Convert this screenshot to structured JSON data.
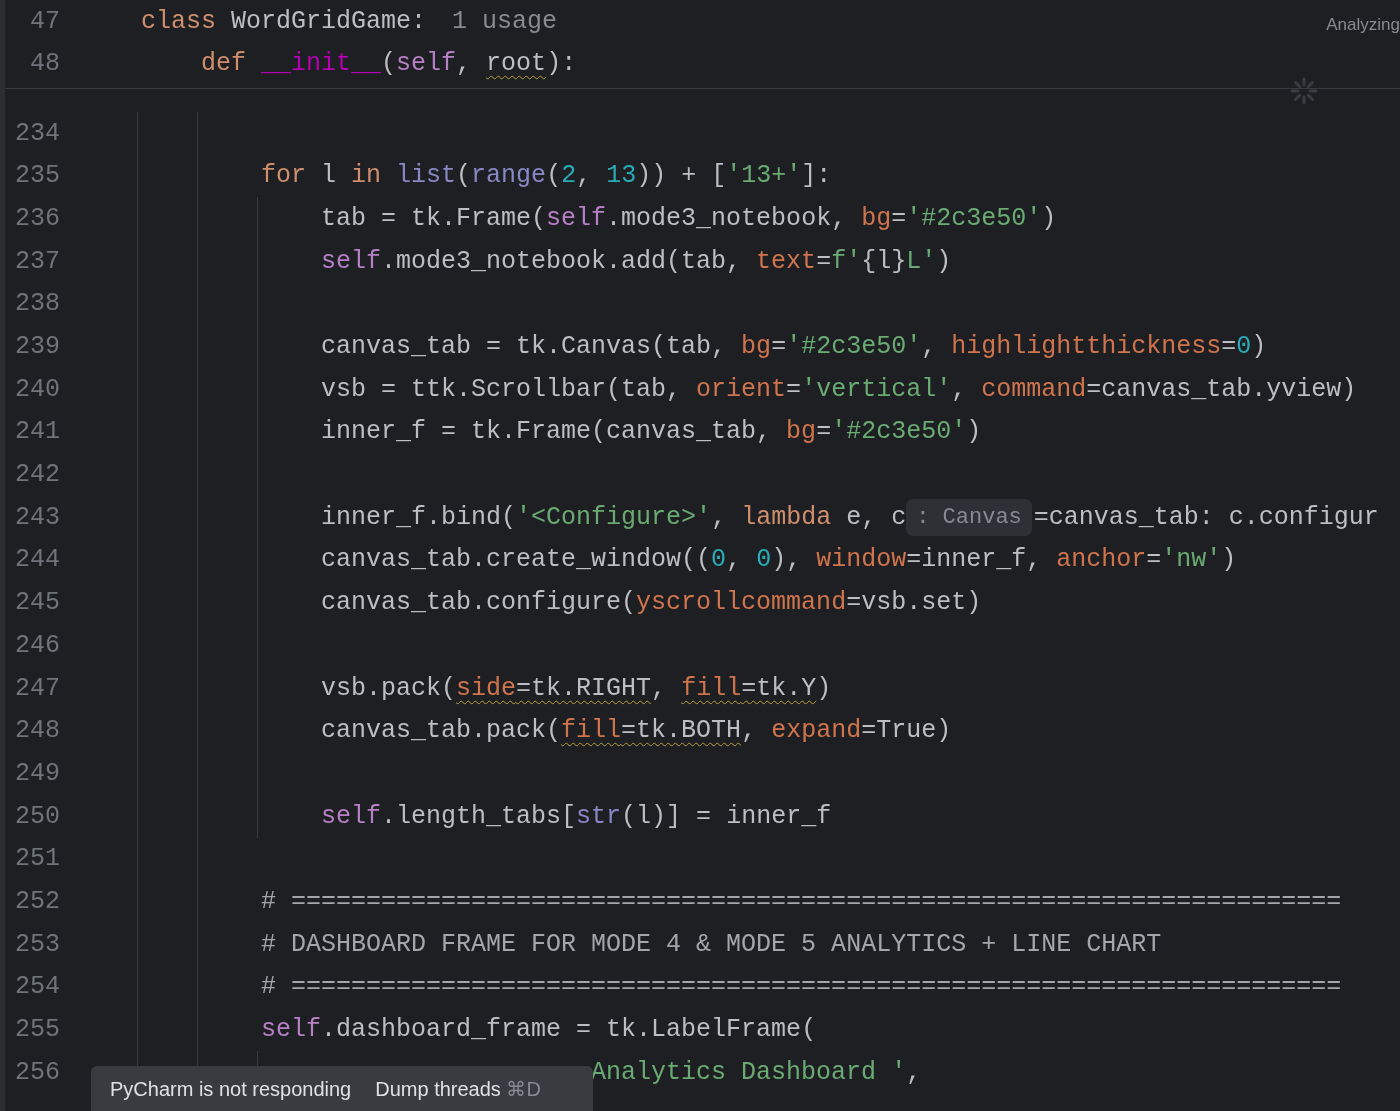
{
  "sticky_lines": [
    {
      "number": "47",
      "tokens": [
        {
          "text": "class",
          "kind": "kw"
        },
        {
          "text": " WordGridGame:",
          "kind": "plain"
        },
        {
          "text": "1 usage",
          "kind": "usage"
        }
      ]
    },
    {
      "number": "48",
      "tokens": [
        {
          "text": "    def ",
          "kind": "kw"
        },
        {
          "text": "__init__",
          "kind": "magic"
        },
        {
          "text": "(",
          "kind": "plain"
        },
        {
          "text": "self",
          "kind": "self"
        },
        {
          "text": ", ",
          "kind": "plain"
        },
        {
          "text": "root",
          "kind": "plain",
          "warn": true
        },
        {
          "text": "):",
          "kind": "plain"
        }
      ]
    }
  ],
  "status": "Analyzing",
  "lines": [
    {
      "number": "234"
    },
    {
      "number": "235",
      "tokens": [
        {
          "text": "        for",
          "kind": "kw"
        },
        {
          "text": " l ",
          "kind": "plain"
        },
        {
          "text": "in ",
          "kind": "kw"
        },
        {
          "text": "list",
          "kind": "builtin"
        },
        {
          "text": "(",
          "kind": "plain"
        },
        {
          "text": "range",
          "kind": "builtin"
        },
        {
          "text": "(",
          "kind": "plain"
        },
        {
          "text": "2",
          "kind": "num"
        },
        {
          "text": ", ",
          "kind": "plain"
        },
        {
          "text": "13",
          "kind": "num"
        },
        {
          "text": ")) + [",
          "kind": "plain"
        },
        {
          "text": "'13+'",
          "kind": "str"
        },
        {
          "text": "]:",
          "kind": "plain"
        }
      ]
    },
    {
      "number": "236",
      "tokens": [
        {
          "text": "            tab = tk.Frame(",
          "kind": "plain"
        },
        {
          "text": "self",
          "kind": "self"
        },
        {
          "text": ".mode3_notebook, ",
          "kind": "plain"
        },
        {
          "text": "bg",
          "kind": "param"
        },
        {
          "text": "=",
          "kind": "plain"
        },
        {
          "text": "'#2c3e50'",
          "kind": "str"
        },
        {
          "text": ")",
          "kind": "plain"
        }
      ]
    },
    {
      "number": "237",
      "tokens": [
        {
          "text": "            self",
          "kind": "self"
        },
        {
          "text": ".mode3_notebook.add(tab, ",
          "kind": "plain"
        },
        {
          "text": "text",
          "kind": "param"
        },
        {
          "text": "=",
          "kind": "plain"
        },
        {
          "text": "f'",
          "kind": "str"
        },
        {
          "text": "{l}",
          "kind": "plain"
        },
        {
          "text": "L'",
          "kind": "str"
        },
        {
          "text": ")",
          "kind": "plain"
        }
      ]
    },
    {
      "number": "238"
    },
    {
      "number": "239",
      "tokens": [
        {
          "text": "            canvas_tab = tk.Canvas(tab, ",
          "kind": "plain"
        },
        {
          "text": "bg",
          "kind": "param"
        },
        {
          "text": "=",
          "kind": "plain"
        },
        {
          "text": "'#2c3e50'",
          "kind": "str"
        },
        {
          "text": ", ",
          "kind": "plain"
        },
        {
          "text": "highlightthickness",
          "kind": "param"
        },
        {
          "text": "=",
          "kind": "plain"
        },
        {
          "text": "0",
          "kind": "num"
        },
        {
          "text": ")",
          "kind": "plain"
        }
      ]
    },
    {
      "number": "240",
      "tokens": [
        {
          "text": "            vsb = ttk.Scrollbar(tab, ",
          "kind": "plain"
        },
        {
          "text": "orient",
          "kind": "param"
        },
        {
          "text": "=",
          "kind": "plain"
        },
        {
          "text": "'vertical'",
          "kind": "str"
        },
        {
          "text": ", ",
          "kind": "plain"
        },
        {
          "text": "command",
          "kind": "param"
        },
        {
          "text": "=canvas_tab.yview)",
          "kind": "plain"
        }
      ]
    },
    {
      "number": "241",
      "tokens": [
        {
          "text": "            inner_f = tk.Frame(canvas_tab, ",
          "kind": "plain"
        },
        {
          "text": "bg",
          "kind": "param"
        },
        {
          "text": "=",
          "kind": "plain"
        },
        {
          "text": "'#2c3e50'",
          "kind": "str"
        },
        {
          "text": ")",
          "kind": "plain"
        }
      ]
    },
    {
      "number": "242"
    },
    {
      "number": "243",
      "tokens": [
        {
          "text": "            inner_f.bind(",
          "kind": "plain"
        },
        {
          "text": "'<Configure>'",
          "kind": "str"
        },
        {
          "text": ", ",
          "kind": "plain"
        },
        {
          "text": "lambda",
          "kind": "kw"
        },
        {
          "text": " e, c",
          "kind": "plain"
        },
        {
          "text": ": Canvas",
          "kind": "hint"
        },
        {
          "text": "=canvas_tab: c.configur",
          "kind": "plain"
        }
      ]
    },
    {
      "number": "244",
      "tokens": [
        {
          "text": "            canvas_tab.create_window((",
          "kind": "plain"
        },
        {
          "text": "0",
          "kind": "num"
        },
        {
          "text": ", ",
          "kind": "plain"
        },
        {
          "text": "0",
          "kind": "num"
        },
        {
          "text": "), ",
          "kind": "plain"
        },
        {
          "text": "window",
          "kind": "param"
        },
        {
          "text": "=inner_f, ",
          "kind": "plain"
        },
        {
          "text": "anchor",
          "kind": "param"
        },
        {
          "text": "=",
          "kind": "plain"
        },
        {
          "text": "'nw'",
          "kind": "str"
        },
        {
          "text": ")",
          "kind": "plain"
        }
      ]
    },
    {
      "number": "245",
      "tokens": [
        {
          "text": "            canvas_tab.configure(",
          "kind": "plain"
        },
        {
          "text": "yscrollcommand",
          "kind": "param"
        },
        {
          "text": "=vsb.set)",
          "kind": "plain"
        }
      ]
    },
    {
      "number": "246"
    },
    {
      "number": "247",
      "tokens": [
        {
          "text": "            vsb.pack(",
          "kind": "plain"
        },
        {
          "text": "side",
          "kind": "param",
          "warn": true
        },
        {
          "text": "=tk.RIGHT",
          "kind": "plain",
          "warn": true
        },
        {
          "text": ", ",
          "kind": "plain"
        },
        {
          "text": "fill",
          "kind": "param",
          "warn": true
        },
        {
          "text": "=tk.Y",
          "kind": "plain",
          "warn": true
        },
        {
          "text": ")",
          "kind": "plain"
        }
      ]
    },
    {
      "number": "248",
      "tokens": [
        {
          "text": "            canvas_tab.pack(",
          "kind": "plain"
        },
        {
          "text": "fill",
          "kind": "param",
          "warn": true
        },
        {
          "text": "=tk.BOTH",
          "kind": "plain",
          "warn": true
        },
        {
          "text": ", ",
          "kind": "plain"
        },
        {
          "text": "expand",
          "kind": "param"
        },
        {
          "text": "=True)",
          "kind": "plain"
        }
      ]
    },
    {
      "number": "249"
    },
    {
      "number": "250",
      "tokens": [
        {
          "text": "            self",
          "kind": "self"
        },
        {
          "text": ".length_tabs[",
          "kind": "plain"
        },
        {
          "text": "str",
          "kind": "builtin"
        },
        {
          "text": "(l)] = inner_f",
          "kind": "plain"
        }
      ]
    },
    {
      "number": "251"
    },
    {
      "number": "252",
      "tokens": [
        {
          "text": "        # ======================================================================",
          "kind": "comment"
        }
      ]
    },
    {
      "number": "253",
      "tokens": [
        {
          "text": "        # DASHBOARD FRAME FOR MODE 4 & MODE 5 ANALYTICS + LINE CHART",
          "kind": "comment"
        }
      ]
    },
    {
      "number": "254",
      "tokens": [
        {
          "text": "        # ======================================================================",
          "kind": "comment"
        }
      ]
    },
    {
      "number": "255",
      "tokens": [
        {
          "text": "        self",
          "kind": "self"
        },
        {
          "text": ".dashboard_frame = tk.LabelFrame(",
          "kind": "plain"
        }
      ]
    },
    {
      "number": "256",
      "tokens": [
        {
          "text": "                              Analytics Dashboard '",
          "kind": "str"
        },
        {
          "text": ",",
          "kind": "plain"
        }
      ]
    }
  ],
  "toast": {
    "message": "PyCharm is not responding",
    "action": "Dump threads",
    "shortcut": "⌘D"
  }
}
